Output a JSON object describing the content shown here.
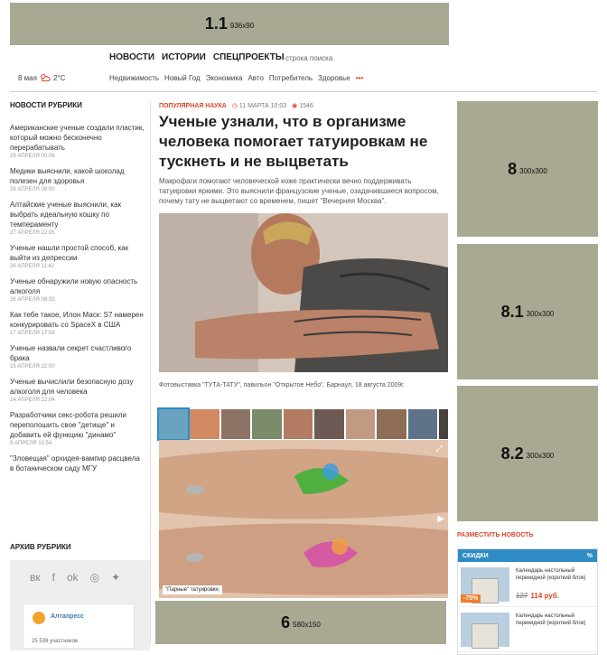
{
  "ads": {
    "top": {
      "id": "1.1",
      "size": "936x90"
    },
    "r1": {
      "id": "8",
      "size": "300x300"
    },
    "r2": {
      "id": "8.1",
      "size": "300x300"
    },
    "r3": {
      "id": "8.2",
      "size": "300x300"
    },
    "bottom": {
      "id": "6",
      "size": "580x150"
    }
  },
  "nav": {
    "main": [
      "НОВОСТИ",
      "ИСТОРИИ",
      "СПЕЦПРОЕКТЫ"
    ],
    "search_placeholder": "строка поиска",
    "sub": [
      "Недвижимость",
      "Новый Год",
      "Экономика",
      "Авто",
      "Потребитель",
      "Здоровье"
    ],
    "more": "•••"
  },
  "weather": {
    "date": "8 мая",
    "temp": "2°C"
  },
  "sidebar": {
    "heading": "НОВОСТИ РУБРИКИ",
    "archive": "АРХИВ РУБРИКИ",
    "items": [
      {
        "title": "Американские ученые создали пластик, который можно бесконечно перерабатывать",
        "date": "29 АПРЕЛЯ 00:06"
      },
      {
        "title": "Медики выяснили, какой шоколад полезен для здоровья",
        "date": "29 АПРЕЛЯ 09:00"
      },
      {
        "title": "Алтайские ученые выяснили, как выбрать идеальную кошку по темпераменту",
        "date": "27 АПРЕЛЯ 22:05"
      },
      {
        "title": "Ученые нашли простой способ, как выйти из депрессии",
        "date": "26 АПРЕЛЯ 11:42"
      },
      {
        "title": "Ученые обнаружили новую опасность алкоголя",
        "date": "26 АПРЕЛЯ 08:33"
      },
      {
        "title": "Как тебе такое, Илон Маск: S7 намерен конкурировать со SpaceX в США",
        "date": "17 АПРЕЛЯ 17:59"
      },
      {
        "title": "Ученые назвали секрет счастливого брака",
        "date": "15 АПРЕЛЯ 22:00"
      },
      {
        "title": "Ученые вычислили безопасную дозу алкоголя для человека",
        "date": "14 АПРЕЛЯ 22:04"
      },
      {
        "title": "Разработчики секс-робота решили переполошить свое \"детище\" и добавить ей функцию \"динамо\"",
        "date": "9 АПРЕЛЯ 10:54"
      },
      {
        "title": "\"Зловещая\" орхидея-вампир расцвела в ботаническом саду МГУ",
        "date": ""
      }
    ],
    "widget": {
      "name": "Алтапресс",
      "count": "25 538 участников"
    }
  },
  "article": {
    "category": "ПОПУЛЯРНАЯ НАУКА",
    "date": "11 МАРТА 10:03",
    "views": "1546",
    "title": "Ученые узнали, что в организме человека помогает татуировкам не тускнеть и не выцветать",
    "lead": "Макрофаги помогают человеческой коже практически вечно поддерживать татуировки яркими. Это выяснили французские ученые, озадачившиеся вопросом, почему тату не выцветают со временем, пишет \"Вечерняя Москва\".",
    "photo_caption": "Фотовыставка \"ТУТА-ТАТУ\", павильон \"Открытое Небо\". Барнаул, 18 августа 2009г.",
    "gallery_caption": "\"Парные\" татуировки."
  },
  "right": {
    "place_news": "РАЗМЕСТИТЬ НОВОСТЬ",
    "discount": {
      "heading": "СКИДКИ",
      "mark": "%",
      "items": [
        {
          "title": "Календарь настольный перекидной (короткий блок)",
          "badge": "-75%",
          "old": "127",
          "new": "114 руб."
        },
        {
          "title": "Календарь настольный перекидной (короткий блок)",
          "badge": "",
          "old": "",
          "new": ""
        }
      ]
    }
  },
  "colors": {
    "accent": "#e0442b",
    "ad": "#a9a892",
    "discount": "#2e8bc4"
  }
}
